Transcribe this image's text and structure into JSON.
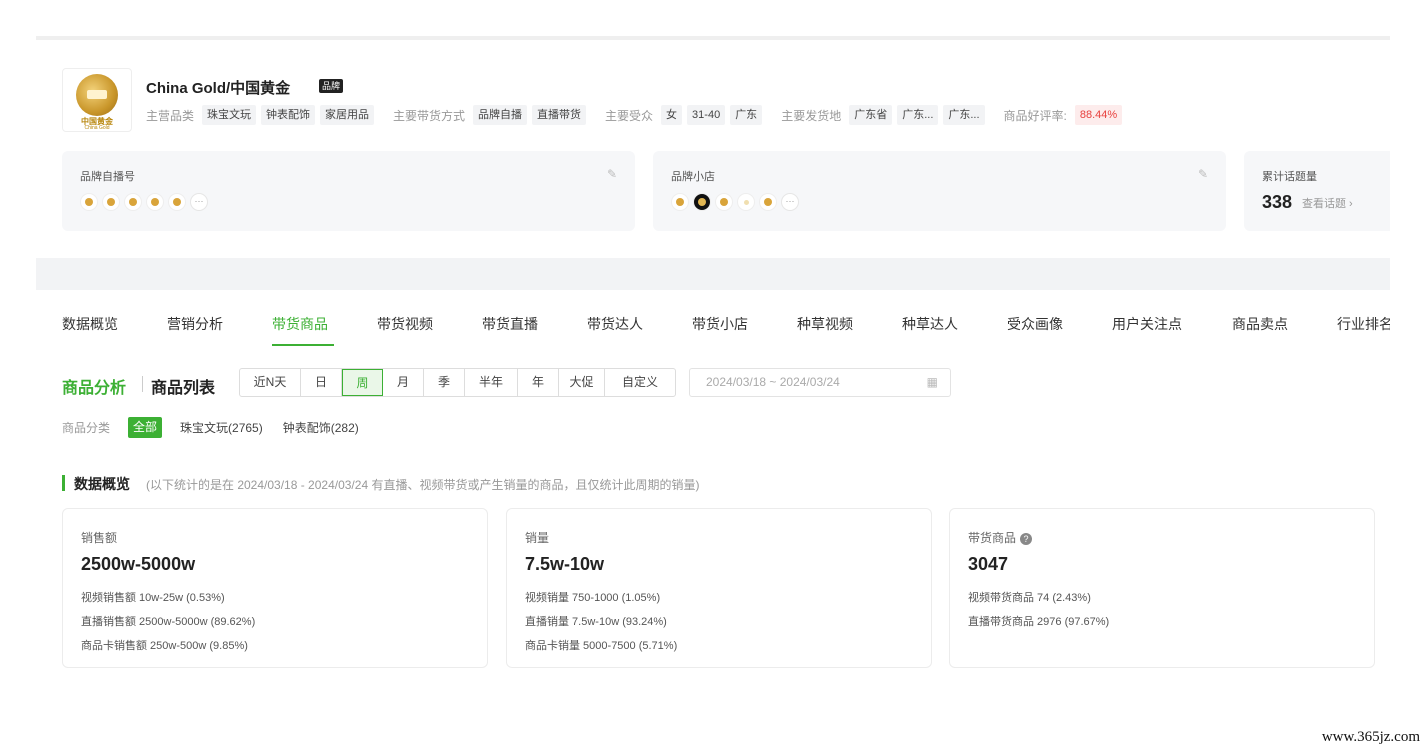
{
  "brand": {
    "name": "China Gold/中国黄金",
    "badge": "品牌",
    "logo_text": "中国黄金",
    "logo_sub": "China Gold"
  },
  "meta": {
    "category_label": "主营品类",
    "categories": [
      "珠宝文玩",
      "钟表配饰",
      "家居用品"
    ],
    "method_label": "主要带货方式",
    "methods": [
      "品牌自播",
      "直播带货"
    ],
    "audience_label": "主要受众",
    "audience": [
      "女",
      "31-40",
      "广东"
    ],
    "ship_label": "主要发货地",
    "ship": [
      "广东省",
      "广东...",
      "广东..."
    ],
    "rating_label": "商品好评率:",
    "rating": "88.44%"
  },
  "cards": {
    "self_broadcast": {
      "title": "品牌自播号",
      "more": "···"
    },
    "brand_store": {
      "title": "品牌小店",
      "more": "···"
    },
    "topics": {
      "title": "累计话题量",
      "count": "338",
      "link": "查看话题 ›"
    }
  },
  "tabs": [
    "数据概览",
    "营销分析",
    "带货商品",
    "带货视频",
    "带货直播",
    "带货达人",
    "带货小店",
    "种草视频",
    "种草达人",
    "受众画像",
    "用户关注点",
    "商品卖点",
    "行业排名"
  ],
  "active_tab": "带货商品",
  "section": {
    "analysis": "商品分析",
    "list": "商品列表"
  },
  "periods": [
    "近N天",
    "日",
    "周",
    "月",
    "季",
    "半年",
    "年",
    "大促",
    "自定义"
  ],
  "active_period": "周",
  "date_range": "2024/03/18 ~ 2024/03/24",
  "category_filter": {
    "label": "商品分类",
    "all": "全部",
    "items": [
      "珠宝文玩(2765)",
      "钟表配饰(282)"
    ]
  },
  "overview": {
    "title": "数据概览",
    "note": "(以下统计的是在 2024/03/18 - 2024/03/24 有直播、视频带货或产生销量的商品，且仅统计此周期的销量)"
  },
  "stats": [
    {
      "label": "销售额",
      "value": "2500w-5000w",
      "lines": [
        "视频销售额 10w-25w (0.53%)",
        "直播销售额 2500w-5000w (89.62%)",
        "商品卡销售额 250w-500w (9.85%)"
      ]
    },
    {
      "label": "销量",
      "value": "7.5w-10w",
      "lines": [
        "视频销量 750-1000 (1.05%)",
        "直播销量 7.5w-10w (93.24%)",
        "商品卡销量 5000-7500 (5.71%)"
      ]
    },
    {
      "label": "带货商品",
      "value": "3047",
      "lines": [
        "视频带货商品 74 (2.43%)",
        "直播带货商品 2976 (97.67%)"
      ]
    }
  ],
  "watermark": "www.365jz.com",
  "colors": {
    "accent": "#3cb034",
    "rating_red": "#e8413e",
    "brand_gold": "#c9962a"
  },
  "icons": {
    "edit": "pencil-icon",
    "calendar": "calendar-icon",
    "help": "question-circle-icon"
  }
}
